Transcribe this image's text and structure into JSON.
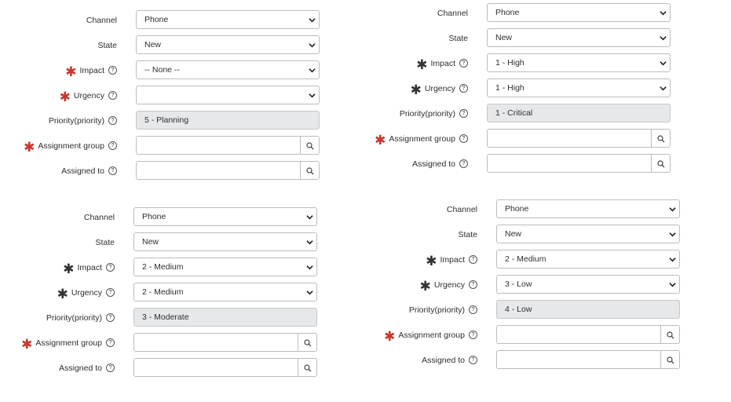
{
  "forms": [
    {
      "channel": {
        "label": "Channel",
        "value": "Phone"
      },
      "state": {
        "label": "State",
        "value": "New"
      },
      "impact": {
        "label": "Impact",
        "value": "-- None --",
        "star_color": "red"
      },
      "urgency": {
        "label": "Urgency",
        "value": "",
        "star_color": "red"
      },
      "priority": {
        "label": "Priority(priority)",
        "value": "5 - Planning"
      },
      "assignment_group": {
        "label": "Assignment group",
        "value": ""
      },
      "assigned_to": {
        "label": "Assigned to",
        "value": ""
      }
    },
    {
      "channel": {
        "label": "Channel",
        "value": "Phone"
      },
      "state": {
        "label": "State",
        "value": "New"
      },
      "impact": {
        "label": "Impact",
        "value": "1 - High",
        "star_color": "dark"
      },
      "urgency": {
        "label": "Urgency",
        "value": "1 - High",
        "star_color": "dark"
      },
      "priority": {
        "label": "Priority(priority)",
        "value": "1 - Critical"
      },
      "assignment_group": {
        "label": "Assignment group",
        "value": ""
      },
      "assigned_to": {
        "label": "Assigned to",
        "value": ""
      }
    },
    {
      "channel": {
        "label": "Channel",
        "value": "Phone"
      },
      "state": {
        "label": "State",
        "value": "New"
      },
      "impact": {
        "label": "Impact",
        "value": "2 - Medium",
        "star_color": "dark"
      },
      "urgency": {
        "label": "Urgency",
        "value": "2 - Medium",
        "star_color": "dark"
      },
      "priority": {
        "label": "Priority(priority)",
        "value": "3 - Moderate"
      },
      "assignment_group": {
        "label": "Assignment group",
        "value": ""
      },
      "assigned_to": {
        "label": "Assigned to",
        "value": ""
      }
    },
    {
      "channel": {
        "label": "Channel",
        "value": "Phone"
      },
      "state": {
        "label": "State",
        "value": "New"
      },
      "impact": {
        "label": "Impact",
        "value": "2 - Medium",
        "star_color": "dark"
      },
      "urgency": {
        "label": "Urgency",
        "value": "3 - Low",
        "star_color": "dark"
      },
      "priority": {
        "label": "Priority(priority)",
        "value": "4 - Low"
      },
      "assignment_group": {
        "label": "Assignment group",
        "value": ""
      },
      "assigned_to": {
        "label": "Assigned to",
        "value": ""
      }
    }
  ],
  "colors": {
    "mandatory_star_red": "#c8372d",
    "mandatory_star_dark": "#333333",
    "readonly_bg": "#e6e8ea",
    "border": "#b9bcbe"
  },
  "icons": {
    "dropdown": "chevron-down-icon",
    "lookup": "search-icon",
    "help": "help-icon",
    "mandatory": "asterisk-icon"
  }
}
